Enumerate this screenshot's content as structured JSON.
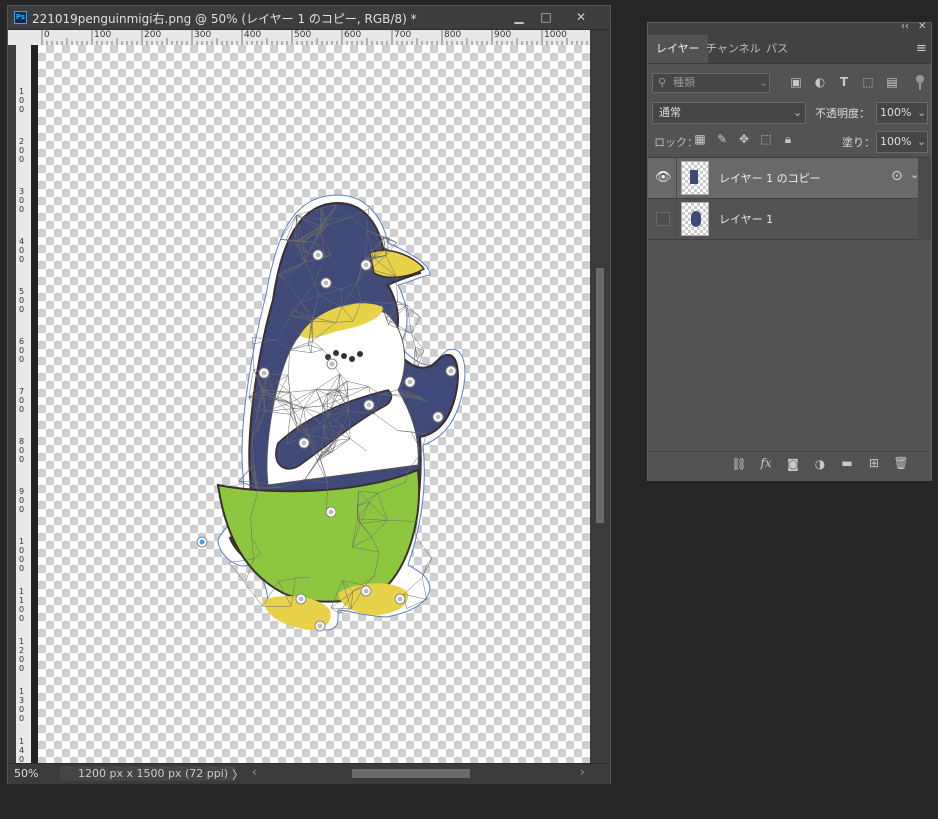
{
  "document": {
    "title": "221019penguinmigi右.png @ 50% (レイヤー 1 のコピー, RGB/8) *",
    "app_icon": "Ps",
    "window_controls": {
      "minimize": "▁",
      "maximize": "□",
      "close": "✕"
    },
    "ruler_h": [
      "0",
      "100",
      "200",
      "300",
      "400",
      "500",
      "600",
      "700",
      "800",
      "900",
      "1000"
    ],
    "ruler_v": [
      "1 0 0",
      "2 0 0",
      "3 0 0",
      "4 0 0",
      "5 0 0",
      "6 0 0",
      "7 0 0",
      "8 0 0",
      "9 0 0",
      "1 0 0 0",
      "1 1 0 0",
      "1 2 0 0",
      "1 3 0 0",
      "1 4 0"
    ],
    "zoom": "50%",
    "doc_info": "1200 px x 1500 px (72 ppi)",
    "status_arrow": "〉",
    "scroll_left": "‹",
    "scroll_right": "›"
  },
  "panel": {
    "collapse": "‹‹",
    "close": "✕",
    "tabs": [
      "レイヤー",
      "チャンネル",
      "パス"
    ],
    "active_tab": 0,
    "menu_icon": "≡",
    "filter": {
      "icon": "search-icon",
      "label": "種類"
    },
    "blend_mode": "通常",
    "opacity_label": "不透明度：",
    "opacity_value": "100%",
    "lock_label": "ロック：",
    "fill_label": "塗り：",
    "fill_value": "100%",
    "layers": [
      {
        "name": "レイヤー 1 のコピー",
        "visible": true,
        "selected": true
      },
      {
        "name": "レイヤー 1",
        "visible": false,
        "selected": false
      }
    ],
    "footer_icons": [
      "link-icon",
      "fx-icon",
      "mask-icon",
      "adjustment-icon",
      "folder-icon",
      "new-layer-icon",
      "trash-icon"
    ],
    "fx_label": "fx"
  },
  "colors": {
    "accent": "#31a8ff",
    "penguin_navy": "#404a78",
    "belly_green": "#8dc63f",
    "beak_yellow": "#e8d24a"
  }
}
